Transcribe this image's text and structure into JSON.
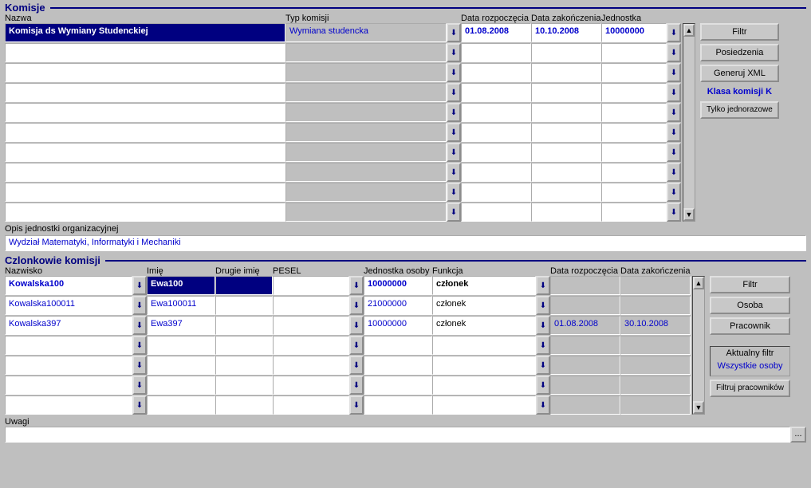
{
  "section1": {
    "title": "Komisje"
  },
  "k_hdr": {
    "nazwa": "Nazwa",
    "typ": "Typ komisji",
    "start": "Data rozpoczęcia",
    "end": "Data zakończenia",
    "jedn": "Jednostka"
  },
  "k_rows": [
    {
      "nazwa": "Komisja ds Wymiany Studenckiej",
      "typ": "Wymiana studencka",
      "start": "01.08.2008",
      "end": "10.10.2008",
      "jedn": "10000000"
    },
    {
      "nazwa": "",
      "typ": "",
      "start": "",
      "end": "",
      "jedn": ""
    },
    {
      "nazwa": "",
      "typ": "",
      "start": "",
      "end": "",
      "jedn": ""
    },
    {
      "nazwa": "",
      "typ": "",
      "start": "",
      "end": "",
      "jedn": ""
    },
    {
      "nazwa": "",
      "typ": "",
      "start": "",
      "end": "",
      "jedn": ""
    },
    {
      "nazwa": "",
      "typ": "",
      "start": "",
      "end": "",
      "jedn": ""
    },
    {
      "nazwa": "",
      "typ": "",
      "start": "",
      "end": "",
      "jedn": ""
    },
    {
      "nazwa": "",
      "typ": "",
      "start": "",
      "end": "",
      "jedn": ""
    },
    {
      "nazwa": "",
      "typ": "",
      "start": "",
      "end": "",
      "jedn": ""
    },
    {
      "nazwa": "",
      "typ": "",
      "start": "",
      "end": "",
      "jedn": ""
    }
  ],
  "side1": {
    "filtr": "Filtr",
    "posiedz": "Posiedzenia",
    "genxml": "Generuj XML",
    "klasa": "Klasa komisji K",
    "tylko": "Tylko jednorazowe"
  },
  "opis": {
    "label": "Opis jednostki organizacyjnej",
    "value": "Wydział Matematyki, Informatyki i Mechaniki"
  },
  "section2": {
    "title": "Czlonkowie komisji"
  },
  "c_hdr": {
    "nazwisko": "Nazwisko",
    "imie": "Imię",
    "drugie": "Drugie imię",
    "pesel": "PESEL",
    "jedn": "Jednostka osoby",
    "funk": "Funkcja",
    "start": "Data rozpoczęcia",
    "end": "Data zakończenia"
  },
  "c_rows": [
    {
      "nazwisko": "Kowalska100",
      "imie": "Ewa100",
      "drugie": "",
      "pesel": "",
      "jedn": "10000000",
      "funk": "członek",
      "start": "",
      "end": ""
    },
    {
      "nazwisko": "Kowalska100011",
      "imie": "Ewa100011",
      "drugie": "",
      "pesel": "",
      "jedn": "21000000",
      "funk": "członek",
      "start": "",
      "end": ""
    },
    {
      "nazwisko": "Kowalska397",
      "imie": "Ewa397",
      "drugie": "",
      "pesel": "",
      "jedn": "10000000",
      "funk": "członek",
      "start": "01.08.2008",
      "end": "30.10.2008"
    },
    {
      "nazwisko": "",
      "imie": "",
      "drugie": "",
      "pesel": "",
      "jedn": "",
      "funk": "",
      "start": "",
      "end": ""
    },
    {
      "nazwisko": "",
      "imie": "",
      "drugie": "",
      "pesel": "",
      "jedn": "",
      "funk": "",
      "start": "",
      "end": ""
    },
    {
      "nazwisko": "",
      "imie": "",
      "drugie": "",
      "pesel": "",
      "jedn": "",
      "funk": "",
      "start": "",
      "end": ""
    },
    {
      "nazwisko": "",
      "imie": "",
      "drugie": "",
      "pesel": "",
      "jedn": "",
      "funk": "",
      "start": "",
      "end": ""
    }
  ],
  "side2": {
    "filtr": "Filtr",
    "osoba": "Osoba",
    "prac": "Pracownik",
    "aktfiltr_title": "Aktualny filtr",
    "aktfiltr_val": "Wszystkie osoby",
    "filtruj": "Filtruj pracowników"
  },
  "uwagi": {
    "label": "Uwagi"
  }
}
